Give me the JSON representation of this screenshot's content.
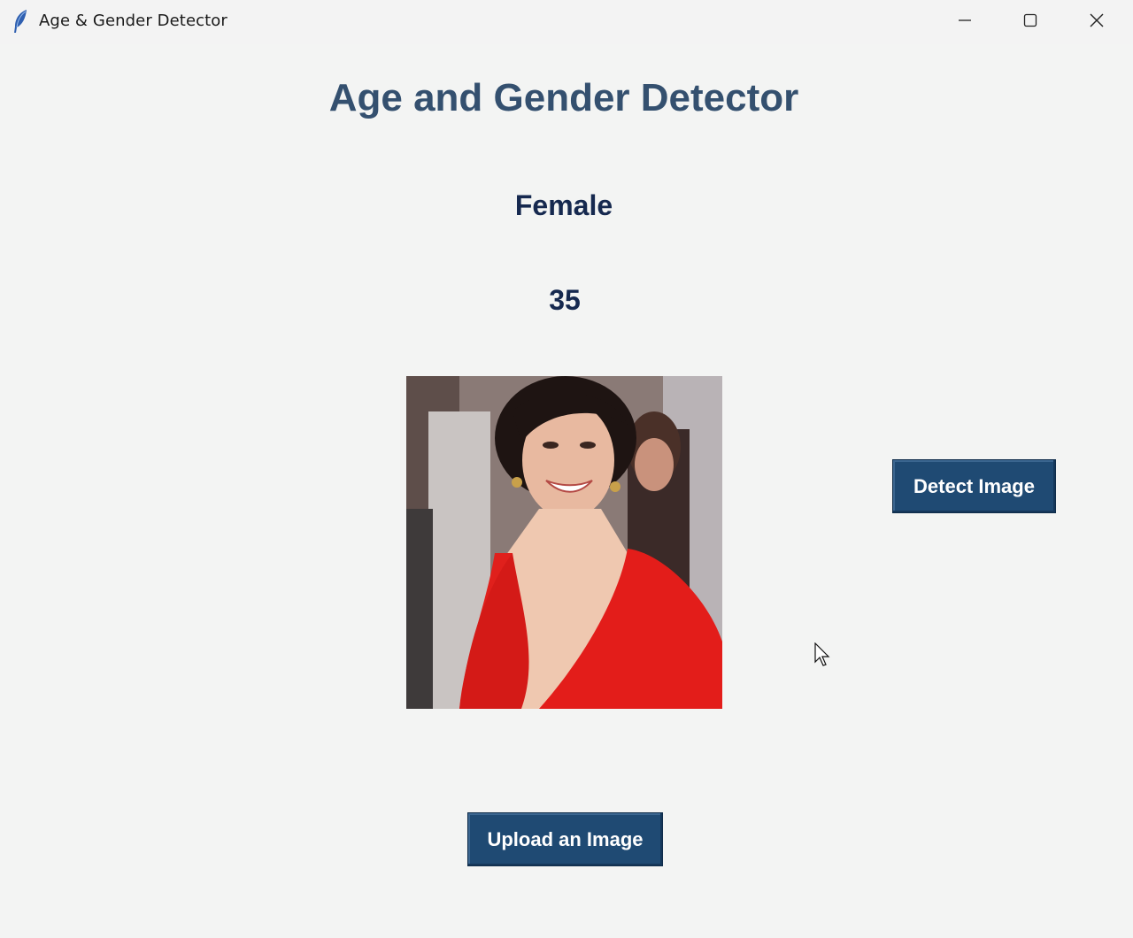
{
  "window": {
    "title": "Age & Gender Detector",
    "app_icon": "feather-icon",
    "controls": {
      "minimize_icon": "minimize-icon",
      "maximize_icon": "maximize-icon",
      "close_icon": "close-icon"
    }
  },
  "main": {
    "heading": "Age and Gender Detector",
    "gender_result": "Female",
    "age_result": "35",
    "photo_description_icon": "uploaded-photo",
    "detect_button_label": "Detect Image",
    "upload_button_label": "Upload an Image"
  },
  "colors": {
    "heading": "#34506f",
    "result_text": "#16294f",
    "button_bg": "#1f4a73",
    "button_text": "#ffffff",
    "background": "#f3f4f3"
  }
}
